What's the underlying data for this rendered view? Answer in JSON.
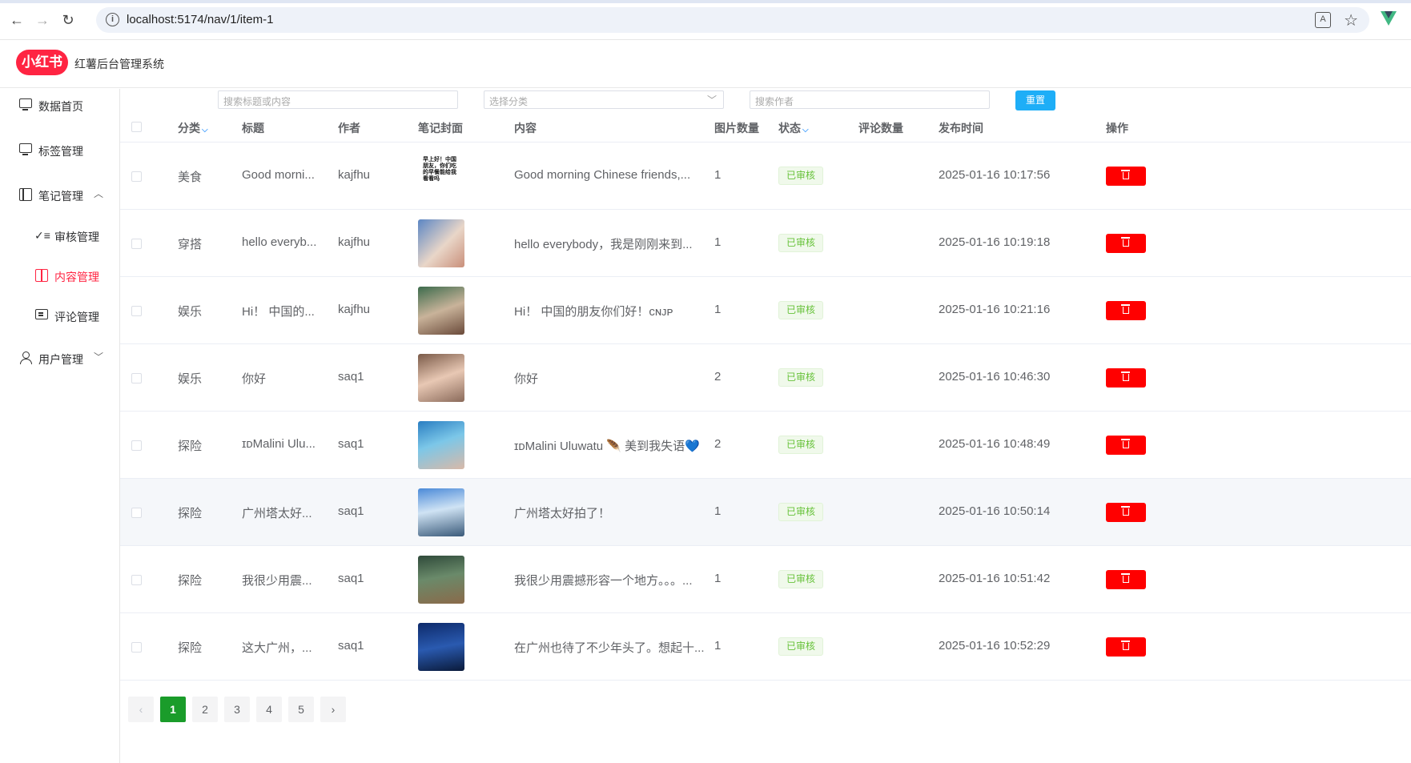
{
  "browser": {
    "url": "localhost:5174/nav/1/item-1"
  },
  "app": {
    "logo_text": "小红书",
    "title": "红薯后台管理系统"
  },
  "sidebar": {
    "items": [
      {
        "label": "数据首页",
        "icon": "monitor-icon"
      },
      {
        "label": "标签管理",
        "icon": "monitor-icon"
      },
      {
        "label": "笔记管理",
        "icon": "book-icon",
        "expanded": true
      },
      {
        "label": "审核管理",
        "icon": "check-list-icon"
      },
      {
        "label": "内容管理",
        "icon": "open-book-icon",
        "active": true
      },
      {
        "label": "评论管理",
        "icon": "comment-icon"
      },
      {
        "label": "用户管理",
        "icon": "user-icon",
        "expanded": false
      }
    ]
  },
  "filters": {
    "search_placeholder": "搜索标题或内容",
    "category_placeholder": "选择分类",
    "author_placeholder": "搜索作者",
    "reset_label": "重置"
  },
  "table": {
    "columns": [
      "分类",
      "标题",
      "作者",
      "笔记封面",
      "内容",
      "图片数量",
      "状态",
      "评论数量",
      "发布时间",
      "操作"
    ],
    "rows": [
      {
        "category": "美食",
        "title": "Good morni...",
        "author": "kajfhu",
        "content": "Good morning Chinese friends,...",
        "images": "1",
        "status": "已审核",
        "comments": "",
        "time": "2025-01-16 10:17:56"
      },
      {
        "category": "穿搭",
        "title": "hello everyb...",
        "author": "kajfhu",
        "content": "hello everybody，我是刚刚来到...",
        "images": "1",
        "status": "已审核",
        "comments": "",
        "time": "2025-01-16 10:19:18"
      },
      {
        "category": "娱乐",
        "title": "Hi！ 中国的...",
        "author": "kajfhu",
        "content": "Hi！ 中国的朋友你们好！ᴄɴᴊᴘ",
        "images": "1",
        "status": "已审核",
        "comments": "",
        "time": "2025-01-16 10:21:16"
      },
      {
        "category": "娱乐",
        "title": "你好",
        "author": "saq1",
        "content": "你好",
        "images": "2",
        "status": "已审核",
        "comments": "",
        "time": "2025-01-16 10:46:30"
      },
      {
        "category": "探险",
        "title": "ɪᴅMalini Ulu...",
        "author": "saq1",
        "content": "ɪᴅMalini Uluwatu 🪶 美到我失语💙",
        "images": "2",
        "status": "已审核",
        "comments": "",
        "time": "2025-01-16 10:48:49"
      },
      {
        "category": "探险",
        "title": "广州塔太好...",
        "author": "saq1",
        "content": "广州塔太好拍了！",
        "images": "1",
        "status": "已审核",
        "comments": "",
        "time": "2025-01-16 10:50:14"
      },
      {
        "category": "探险",
        "title": "我很少用震...",
        "author": "saq1",
        "content": "我很少用震撼形容一个地方。。。...",
        "images": "1",
        "status": "已审核",
        "comments": "",
        "time": "2025-01-16 10:51:42"
      },
      {
        "category": "探险",
        "title": "这大广州，...",
        "author": "saq1",
        "content": "在广州也待了不少年头了。想起十...",
        "images": "1",
        "status": "已审核",
        "comments": "",
        "time": "2025-01-16 10:52:29"
      }
    ],
    "cover1_text": "早上好！中国朋友，你们吃的早餐能给我看看吗"
  },
  "pagination": {
    "prev": "‹",
    "pages": [
      "1",
      "2",
      "3",
      "4",
      "5"
    ],
    "current": "1",
    "next": "›"
  },
  "colors": {
    "brand": "#ff2442",
    "primary": "#1eaef7",
    "danger": "#ff0000",
    "success": "#67c23a",
    "page_active": "#1a9c2a"
  }
}
